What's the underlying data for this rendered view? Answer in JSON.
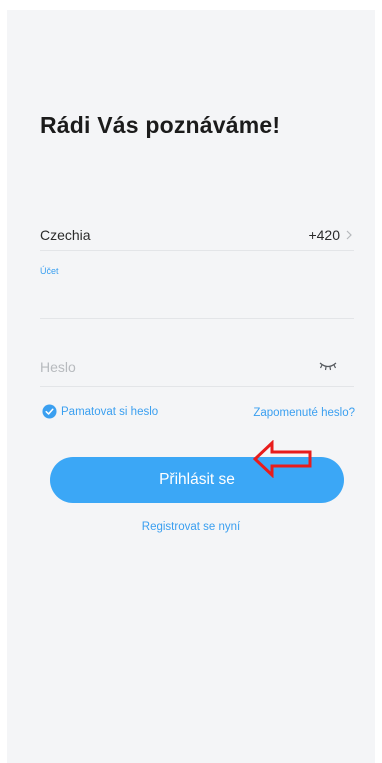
{
  "login": {
    "title": "Rádi Vás poznáváme!",
    "country": {
      "name": "Czechia",
      "code": "+420"
    },
    "account_label": "Účet",
    "account_value": "",
    "password_placeholder": "Heslo",
    "remember_label": "Pamatovat si heslo",
    "remember_checked": true,
    "forgot_label": "Zapomenuté heslo?",
    "login_button": "Přihlásit se",
    "register_link": "Registrovat se nyní"
  },
  "colors": {
    "background": "#f4f5f7",
    "accent": "#3a9ff0",
    "button": "#3ba7f6",
    "annotation_arrow": "#e81c1c"
  },
  "icons": {
    "country_chevron": "chevron-right-icon",
    "password_toggle": "eye-closed-icon",
    "remember_check": "check-circle-icon",
    "annotation": "arrow-left-icon"
  }
}
